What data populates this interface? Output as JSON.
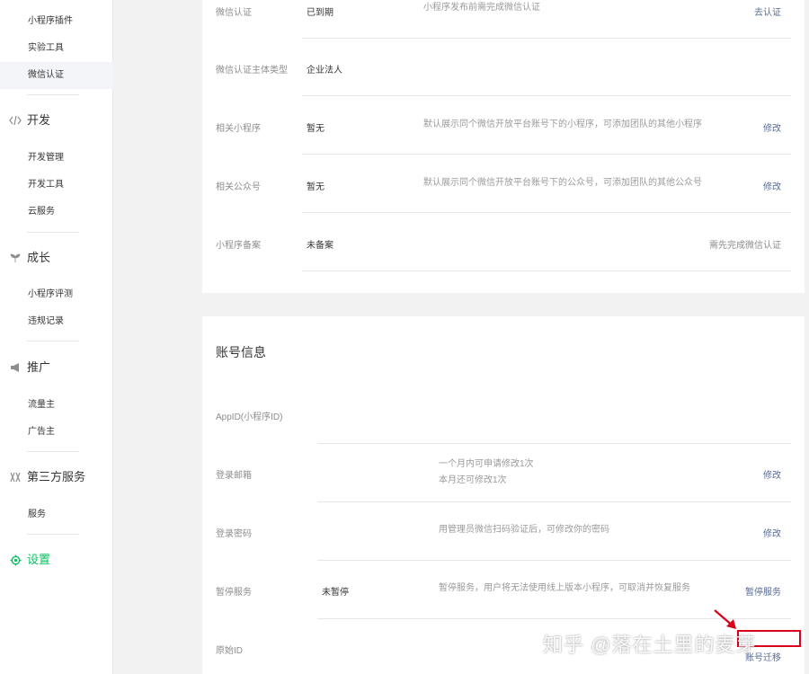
{
  "sidebar": {
    "items_top": [
      {
        "label": "小程序插件"
      },
      {
        "label": "实验工具"
      },
      {
        "label": "微信认证"
      }
    ],
    "groups": [
      {
        "label": "开发",
        "icon": "code-icon",
        "items": [
          "开发管理",
          "开发工具",
          "云服务"
        ]
      },
      {
        "label": "成长",
        "icon": "sprout-icon",
        "items": [
          "小程序评测",
          "违规记录"
        ]
      },
      {
        "label": "推广",
        "icon": "megaphone-icon",
        "items": [
          "流量主",
          "广告主"
        ]
      },
      {
        "label": "第三方服务",
        "icon": "third-party-icon",
        "items": [
          "服务"
        ]
      },
      {
        "label": "设置",
        "icon": "gear-icon",
        "items": []
      }
    ]
  },
  "basic_info": {
    "rows": [
      {
        "label": "微信认证",
        "value": "已到期",
        "desc": "小程序发布前需完成微信认证",
        "action": "去认证"
      },
      {
        "label": "微信认证主体类型",
        "value": "企业法人",
        "desc": "",
        "action": ""
      },
      {
        "label": "相关小程序",
        "value": "暂无",
        "desc": "默认展示同个微信开放平台账号下的小程序，可添加团队的其他小程序",
        "action": "修改"
      },
      {
        "label": "相关公众号",
        "value": "暂无",
        "desc": "默认展示同个微信开放平台账号下的公众号，可添加团队的其他公众号",
        "action": "修改"
      },
      {
        "label": "小程序备案",
        "value": "未备案",
        "desc": "",
        "action": "需先完成微信认证"
      }
    ]
  },
  "account_info": {
    "title": "账号信息",
    "rows": [
      {
        "label": "AppID(小程序ID)",
        "value": "",
        "desc": "",
        "desc2": "",
        "action": "",
        "action2": ""
      },
      {
        "label": "登录邮箱",
        "value": "",
        "desc": "一个月内可申请修改1次",
        "desc2": "本月还可修改1次",
        "action": "修改",
        "action2": ""
      },
      {
        "label": "登录密码",
        "value": "",
        "desc": "用管理员微信扫码验证后，可修改你的密码",
        "desc2": "",
        "action": "修改",
        "action2": ""
      },
      {
        "label": "暂停服务",
        "value": "未暂停",
        "desc": "暂停服务，用户将无法使用线上版本小程序，可取消并恢复服务",
        "desc2": "",
        "action": "暂停服务",
        "action2": ""
      },
      {
        "label": "原始ID",
        "value": "",
        "desc": "",
        "desc2": "",
        "action": "",
        "action2": "账号迁移"
      }
    ]
  },
  "watermark": "知乎 @落在土里的麦芽",
  "colors": {
    "accent_green": "#07c160",
    "link_blue": "#576b95",
    "annotation_red": "#d9001b"
  }
}
